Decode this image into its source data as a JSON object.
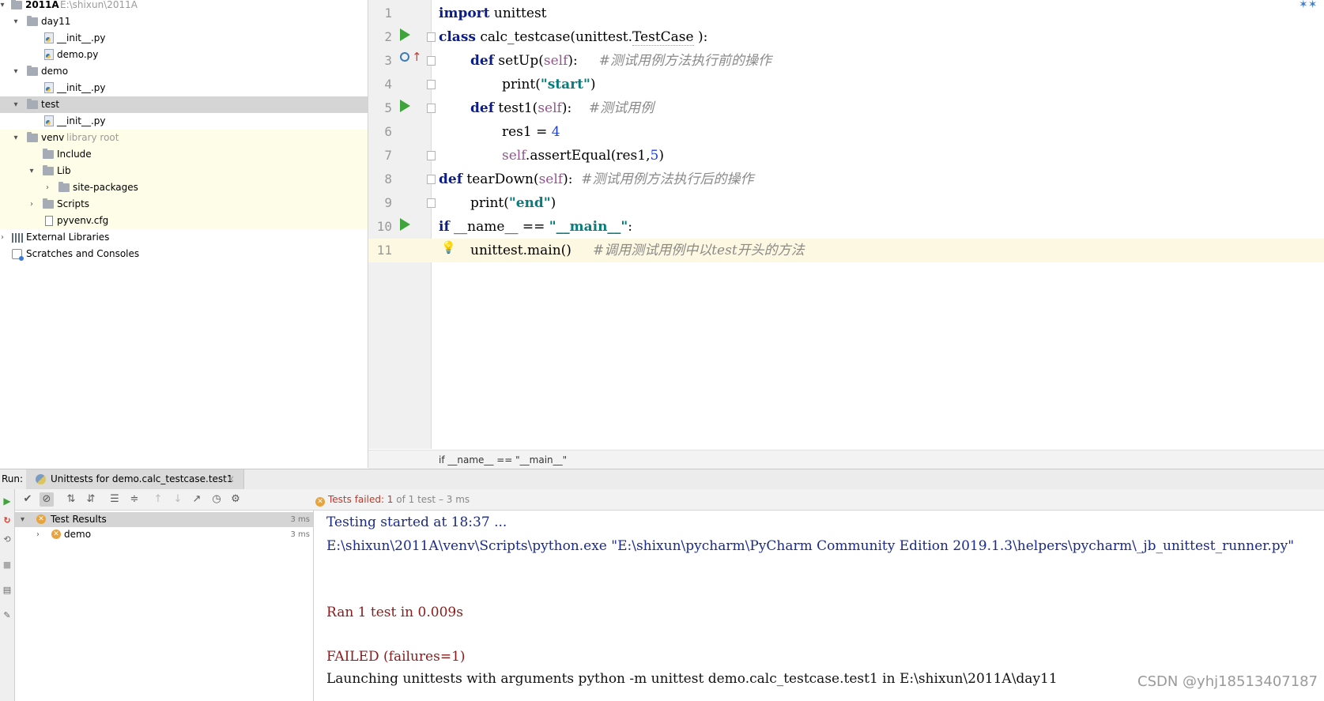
{
  "project_tree": {
    "root": {
      "name": "2011A",
      "path": "E:\\shixun\\2011A"
    },
    "rows": [
      {
        "label": "day11"
      },
      {
        "label": "__init__.py"
      },
      {
        "label": "demo.py"
      },
      {
        "label": "demo"
      },
      {
        "label": "__init__.py"
      },
      {
        "label": "test"
      },
      {
        "label": "__init__.py"
      },
      {
        "label": "venv",
        "sub": "library root"
      },
      {
        "label": "Include"
      },
      {
        "label": "Lib"
      },
      {
        "label": "site-packages"
      },
      {
        "label": "Scripts"
      },
      {
        "label": "pyvenv.cfg"
      },
      {
        "label": "External Libraries"
      },
      {
        "label": "Scratches and Consoles"
      }
    ]
  },
  "editor": {
    "line_numbers": [
      "1",
      "2",
      "3",
      "4",
      "5",
      "6",
      "7",
      "8",
      "9",
      "10",
      "11"
    ],
    "breadcrumb": "if __name__ == \"__main__\""
  },
  "run_panel": {
    "label": "Run:",
    "tab_title": "Unittests for demo.calc_testcase.test1",
    "tab_close": "×",
    "status_failed": "Tests failed: 1",
    "status_meta": "of 1 test – 3 ms",
    "results": [
      {
        "label": "Test Results",
        "time": "3 ms"
      },
      {
        "label": "demo",
        "time": "3 ms"
      }
    ],
    "console": {
      "line1": "Testing started at 18:37 ...",
      "line2": "E:\\shixun\\2011A\\venv\\Scripts\\python.exe \"E:\\shixun\\pycharm\\PyCharm Community Edition 2019.1.3\\helpers\\pycharm\\_jb_unittest_runner.py\"",
      "line3": "Ran 1 test in 0.009s",
      "line4": "FAILED (failures=1)",
      "line5": "Launching unittests with arguments python -m unittest demo.calc_testcase.test1 in E:\\shixun\\2011A\\day11"
    }
  },
  "watermark": "CSDN @yhj18513407187",
  "colors": {
    "keyword": "#0b1c8c",
    "string": "#077e7e",
    "self": "#94558d",
    "comment": "#8a8a8a",
    "run_green": "#3ea43b",
    "failed_red": "#c0392b"
  }
}
